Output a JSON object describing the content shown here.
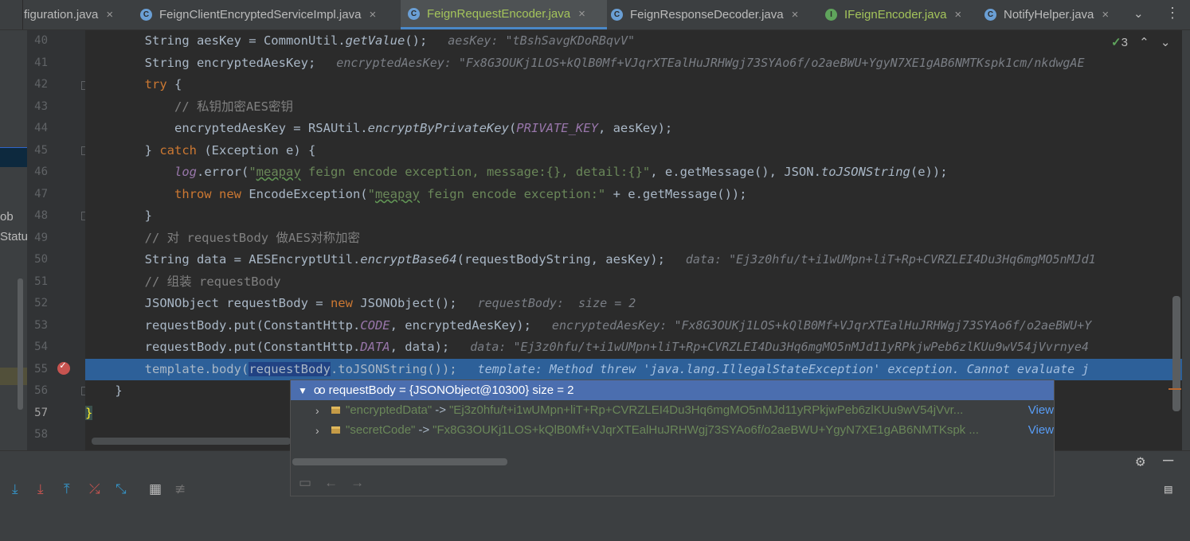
{
  "tabs": [
    {
      "label": "figuration.java",
      "icon": "none",
      "active": false
    },
    {
      "label": "FeignClientEncryptedServiceImpl.java",
      "icon": "C",
      "active": false
    },
    {
      "label": "FeignRequestEncoder.java",
      "icon": "C",
      "active": true
    },
    {
      "label": "FeignResponseDecoder.java",
      "icon": "C",
      "active": false
    },
    {
      "label": "IFeignEncoder.java",
      "icon": "I",
      "active": false
    },
    {
      "label": "NotifyHelper.java",
      "icon": "C",
      "active": false
    }
  ],
  "tab_close": "×",
  "tab_more": "⌄",
  "tab_menu": "⋮",
  "left_panel": {
    "text1": "ob",
    "text2": "Statu"
  },
  "inspection": {
    "count": "3"
  },
  "lines": {
    "n40": "40",
    "n41": "41",
    "n42": "42",
    "n43": "43",
    "n44": "44",
    "n45": "45",
    "n46": "46",
    "n47": "47",
    "n48": "48",
    "n49": "49",
    "n50": "50",
    "n51": "51",
    "n52": "52",
    "n53": "53",
    "n54": "54",
    "n55": "55",
    "n56": "56",
    "n57": "57",
    "n58": "58"
  },
  "code": {
    "l40_a": "String aesKey = CommonUtil.",
    "l40_fn": "getValue",
    "l40_b": "();",
    "l40_hint": "aesKey: \"tBshSavgKDoRBqvV\"",
    "l41_a": "String encryptedAesKey;",
    "l41_hint": "encryptedAesKey: \"Fx8G3OUKj1LOS+kQlB0Mf+VJqrXTEalHuJRHWgj73SYAo6f/o2aeBWU+YgyN7XE1gAB6NMTKspk1cm/nkdwgAE",
    "l42_kw": "try",
    "l42_b": " {",
    "l43_cmt": "// 私钥加密AES密钥",
    "l44_a": "encryptedAesKey = RSAUtil.",
    "l44_fn": "encryptByPrivateKey",
    "l44_b": "(",
    "l44_const": "PRIVATE_KEY",
    "l44_c": ", aesKey);",
    "l45_a": "} ",
    "l45_kw": "catch",
    "l45_b": " (Exception e) {",
    "l46_log": "log",
    "l46_a": ".error(",
    "l46_str1": "\"",
    "l46_typo": "meapay",
    "l46_str2": " feign encode exception, message:{}, detail:{}\"",
    "l46_b": ", e.getMessage(), JSON.",
    "l46_fn": "toJSONString",
    "l46_c": "(e));",
    "l47_kw1": "throw",
    "l47_kw2": " new",
    "l47_a": " EncodeException(",
    "l47_str1": "\"",
    "l47_typo": "meapay",
    "l47_str2": " feign encode exception:\"",
    "l47_b": " + e.getMessage());",
    "l48_a": "}",
    "l49_cmt": "// 对 requestBody 做AES对称加密",
    "l50_a": "String data = AESEncryptUtil.",
    "l50_fn": "encryptBase64",
    "l50_b": "(requestBodyString, aesKey);",
    "l50_hint": "data: \"Ej3z0hfu/t+i1wUMpn+liT+Rp+CVRZLEI4Du3Hq6mgMO5nMJd1",
    "l51_cmt": "// 组装 requestBody",
    "l52_a": "JSONObject requestBody = ",
    "l52_kw": "new",
    "l52_b": " JSONObject();",
    "l52_hint": "requestBody:  size = 2",
    "l53_a": "requestBody.put(ConstantHttp.",
    "l53_const": "CODE",
    "l53_b": ", encryptedAesKey);",
    "l53_hint": "encryptedAesKey: \"Fx8G3OUKj1LOS+kQlB0Mf+VJqrXTEalHuJRHWgj73SYAo6f/o2aeBWU+Y",
    "l54_a": "requestBody.put(ConstantHttp.",
    "l54_const": "DATA",
    "l54_b": ", data);",
    "l54_hint": "data: \"Ej3z0hfu/t+i1wUMpn+liT+Rp+CVRZLEI4Du3Hq6mgMO5nMJd11yRPkjwPeb6zlKUu9wV54jVvrnye4",
    "l55_a": "template.body(",
    "l55_sel": "requestBody",
    "l55_b": ".toJSONString());",
    "l55_hint": "template: Method threw 'java.lang.IllegalStateException' exception. Cannot evaluate j",
    "l56_a": "}",
    "l57_a": "}"
  },
  "popup": {
    "header": "requestBody = {JSONObject@10300}  size = 2",
    "rows": [
      {
        "key": "\"encryptedData\"",
        "arrow": "->",
        "value": "\"Ej3z0hfu/t+i1wUMpn+liT+Rp+CVRZLEI4Du3Hq6mgMO5nMJd11yRPkjwPeb6zlKUu9wV54jVvr...",
        "view": "View"
      },
      {
        "key": "\"secretCode\"",
        "arrow": "->",
        "value": "\"Fx8G3OUKj1LOS+kQlB0Mf+VJqrXTEalHuJRHWgj73SYAo6f/o2aeBWU+YgyN7XE1gAB6NMTKspk ...",
        "view": "View"
      }
    ]
  },
  "colors": {
    "keyword": "#cc7832",
    "string": "#6a8759",
    "constant": "#9876aa",
    "comment": "#808080",
    "selection": "#214283",
    "exec_line": "#2d6099",
    "popup_header": "#4b6eaf"
  },
  "icons": {
    "debug_step_over": "step-over-icon",
    "debug_step_into": "step-into-icon",
    "debug_step_out": "step-out-icon",
    "debug_force_step": "force-step-into-icon",
    "debug_run_cursor": "run-to-cursor-icon",
    "debug_eval": "evaluate-expression-icon",
    "debug_trace": "trace-icon",
    "settings": "gear-icon"
  }
}
